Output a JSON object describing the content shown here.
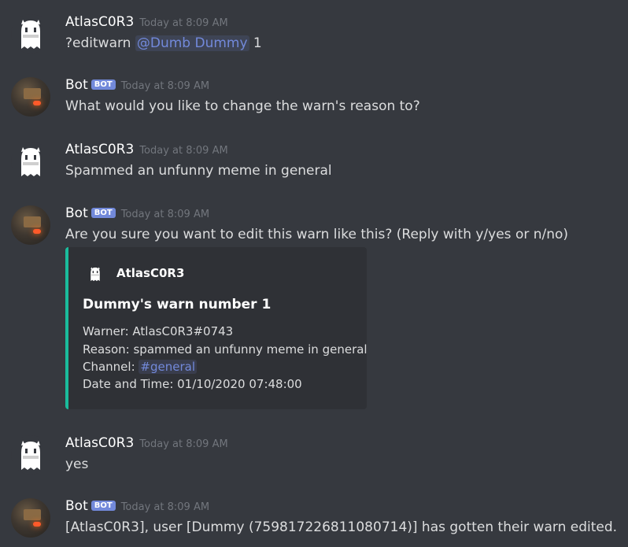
{
  "messages": [
    {
      "author": "AtlasC0R3",
      "timestamp": "Today at 8:09 AM",
      "content_prefix": "?editwarn ",
      "mention": "@Dumb Dummy",
      "content_suffix": " 1"
    },
    {
      "author": "Bot",
      "badge": "BOT",
      "timestamp": "Today at 8:09 AM",
      "content": "What would you like to change the warn's reason to?"
    },
    {
      "author": "AtlasC0R3",
      "timestamp": "Today at 8:09 AM",
      "content": "Spammed an unfunny meme in general"
    },
    {
      "author": "Bot",
      "badge": "BOT",
      "timestamp": "Today at 8:09 AM",
      "content": "Are you sure you want to edit this warn like this? (Reply with y/yes or n/no)"
    },
    {
      "author": "AtlasC0R3",
      "timestamp": "Today at 8:09 AM",
      "content": "yes"
    },
    {
      "author": "Bot",
      "badge": "BOT",
      "timestamp": "Today at 8:09 AM",
      "content": "[AtlasC0R3], user [Dummy (759817226811080714)] has gotten their warn edited."
    }
  ],
  "embed": {
    "author": "AtlasC0R3",
    "title": "Dummy's warn number 1",
    "warner": "Warner: AtlasC0R3#0743",
    "reason": "Reason: spammed an unfunny meme in general",
    "channel_label": "Channel: ",
    "channel": "#general",
    "datetime": "Date and Time: 01/10/2020 07:48:00",
    "accent_color": "#1abc9c"
  },
  "colors": {
    "background": "#36393f",
    "embed_background": "#2f3136",
    "mention": "#7289da",
    "timestamp": "#72767d"
  }
}
